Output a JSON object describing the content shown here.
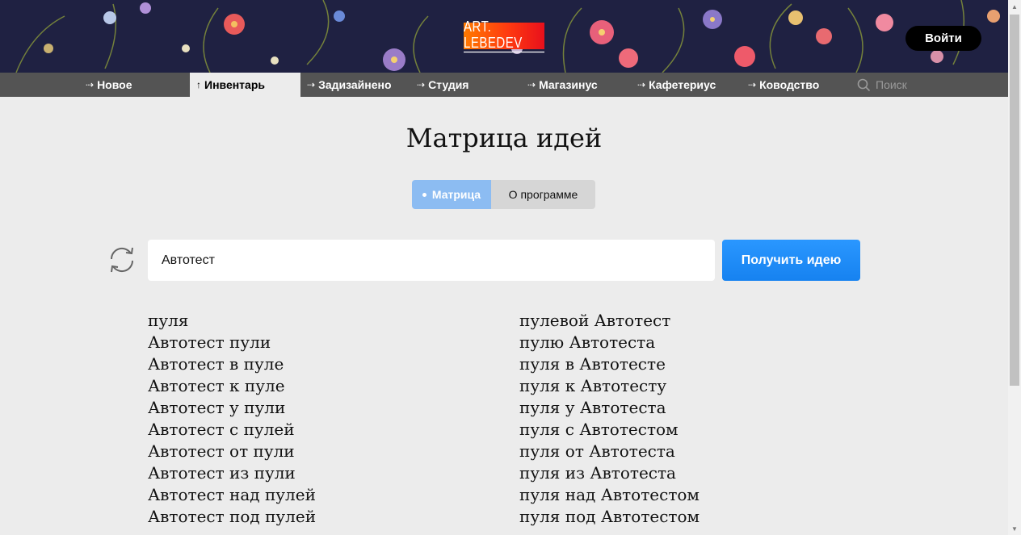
{
  "header": {
    "logo_text": "ART. LEBEDEV",
    "login_label": "Войти"
  },
  "nav": {
    "items": [
      {
        "label": "Новое",
        "arrow": "⇢"
      },
      {
        "label": "Инвентарь",
        "arrow": "↑"
      },
      {
        "label": "Задизайнено",
        "arrow": "⇢"
      },
      {
        "label": "Студия",
        "arrow": "⇢"
      },
      {
        "label": "Магазинус",
        "arrow": "⇢"
      },
      {
        "label": "Кафетериус",
        "arrow": "⇢"
      },
      {
        "label": "Ководство",
        "arrow": "⇢"
      }
    ],
    "active_index": 1,
    "search_label": "Поиск"
  },
  "main": {
    "title": "Матрица идей",
    "tabs": [
      {
        "label": "Матрица",
        "active": true
      },
      {
        "label": "О программе",
        "active": false
      }
    ],
    "search": {
      "value": "Автотест",
      "button_label": "Получить идею"
    },
    "ideas_left": [
      "пуля",
      "Автотест пули",
      "Автотест в пуле",
      "Автотест к пуле",
      "Автотест у пули",
      "Автотест с пулей",
      "Автотест от пули",
      "Автотест из пули",
      "Автотест над пулей",
      "Автотест под пулей"
    ],
    "ideas_right": [
      "пулевой Автотест",
      "пулю Автотеста",
      "пуля в Автотесте",
      "пуля к Автотесту",
      "пуля у Автотеста",
      "пуля с Автотестом",
      "пуля от Автотеста",
      "пуля из Автотеста",
      "пуля над Автотестом",
      "пуля под Автотестом"
    ]
  },
  "colors": {
    "banner_bg": "#1f2142",
    "nav_bg": "#545454",
    "page_bg": "#ececec",
    "accent_blue": "#1682f0",
    "tab_active": "#8cbcf2",
    "logo_orange": "#ff5a10"
  },
  "icons": {
    "search": "search-icon",
    "refresh": "refresh-icon",
    "nav_arrow": "arrow-right-icon"
  }
}
